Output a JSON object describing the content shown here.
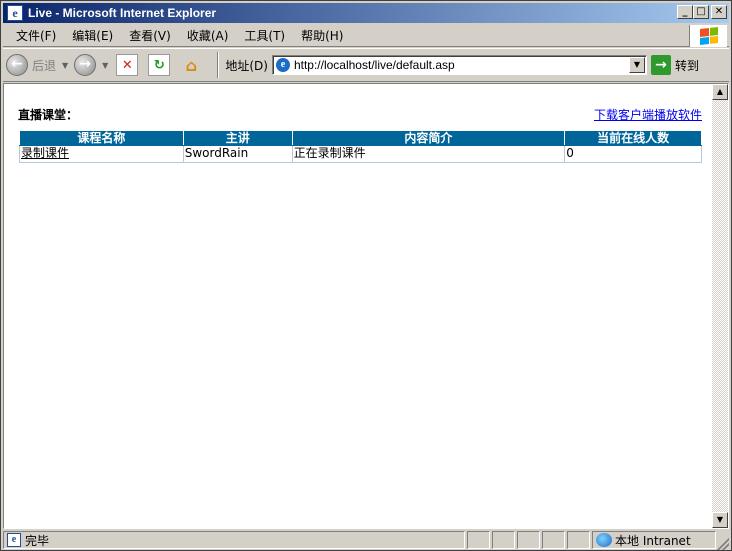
{
  "window": {
    "title": "Live - Microsoft Internet Explorer",
    "controls": {
      "minimize": "_",
      "maximize": "□",
      "close": "✕"
    }
  },
  "menu": {
    "items": [
      "文件(F)",
      "编辑(E)",
      "查看(V)",
      "收藏(A)",
      "工具(T)",
      "帮助(H)"
    ]
  },
  "toolbar": {
    "back_label": "后退",
    "back_glyph": "←",
    "forward_glyph": "→",
    "stop_glyph": "✕",
    "refresh_glyph": "↻",
    "home_glyph": "⌂",
    "address_label": "地址(D)",
    "address_value": "http://localhost/live/default.asp",
    "go_label": "转到",
    "go_glyph": "→"
  },
  "page": {
    "heading": "直播课堂：",
    "download_link": "下载客户端播放软件",
    "table": {
      "headers": [
        "课程名称",
        "主讲",
        "内容简介",
        "当前在线人数"
      ],
      "rows": [
        [
          "录制课件",
          "SwordRain",
          "正在录制课件",
          "0"
        ]
      ]
    }
  },
  "statusbar": {
    "status_text": "完毕",
    "zone_text": "本地 Intranet"
  },
  "icons": {
    "ie_logo": "ie-icon",
    "windows_logo": "windows-flag-icon"
  },
  "colors": {
    "table_header": "#006699",
    "link": "#0000ee",
    "titlebar_start": "#0a246a",
    "titlebar_end": "#a6caf0"
  }
}
